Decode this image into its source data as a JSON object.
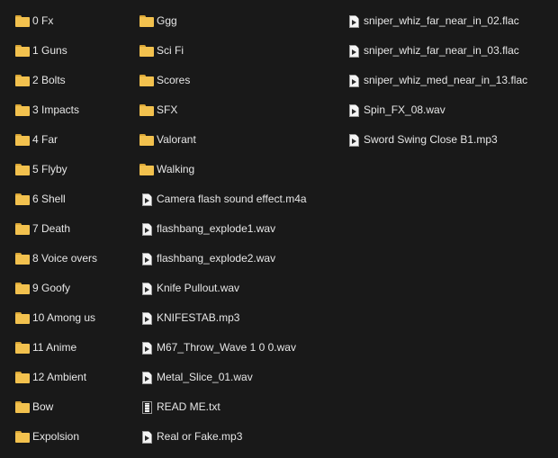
{
  "colors": {
    "background": "#191919",
    "text": "#e6e6e6",
    "folder": "#f2c14e"
  },
  "columns": [
    [
      {
        "name": "0 Fx",
        "type": "folder"
      },
      {
        "name": "1 Guns",
        "type": "folder"
      },
      {
        "name": "2 Bolts",
        "type": "folder"
      },
      {
        "name": "3 Impacts",
        "type": "folder"
      },
      {
        "name": "4 Far",
        "type": "folder"
      },
      {
        "name": "5 Flyby",
        "type": "folder"
      },
      {
        "name": "6 Shell",
        "type": "folder"
      },
      {
        "name": "7 Death",
        "type": "folder"
      },
      {
        "name": "8 Voice overs",
        "type": "folder"
      },
      {
        "name": "9 Goofy",
        "type": "folder"
      },
      {
        "name": "10 Among us",
        "type": "folder"
      },
      {
        "name": "11 Anime",
        "type": "folder"
      },
      {
        "name": "12 Ambient",
        "type": "folder"
      },
      {
        "name": "Bow",
        "type": "folder"
      },
      {
        "name": "Expolsion",
        "type": "folder"
      }
    ],
    [
      {
        "name": "Ggg",
        "type": "folder"
      },
      {
        "name": "Sci Fi",
        "type": "folder"
      },
      {
        "name": "Scores",
        "type": "folder"
      },
      {
        "name": "SFX",
        "type": "folder"
      },
      {
        "name": "Valorant",
        "type": "folder"
      },
      {
        "name": "Walking",
        "type": "folder"
      },
      {
        "name": "Camera flash sound effect.m4a",
        "type": "media"
      },
      {
        "name": "flashbang_explode1.wav",
        "type": "media"
      },
      {
        "name": "flashbang_explode2.wav",
        "type": "media"
      },
      {
        "name": "Knife Pullout.wav",
        "type": "media"
      },
      {
        "name": "KNIFESTAB.mp3",
        "type": "media"
      },
      {
        "name": "M67_Throw_Wave 1 0 0.wav",
        "type": "media"
      },
      {
        "name": "Metal_Slice_01.wav",
        "type": "media"
      },
      {
        "name": "READ ME.txt",
        "type": "text"
      },
      {
        "name": "Real or Fake.mp3",
        "type": "media"
      }
    ],
    [
      {
        "name": "sniper_whiz_far_near_in_02.flac",
        "type": "media"
      },
      {
        "name": "sniper_whiz_far_near_in_03.flac",
        "type": "media"
      },
      {
        "name": "sniper_whiz_med_near_in_13.flac",
        "type": "media"
      },
      {
        "name": "Spin_FX_08.wav",
        "type": "media"
      },
      {
        "name": "Sword Swing Close B1.mp3",
        "type": "media"
      }
    ]
  ]
}
